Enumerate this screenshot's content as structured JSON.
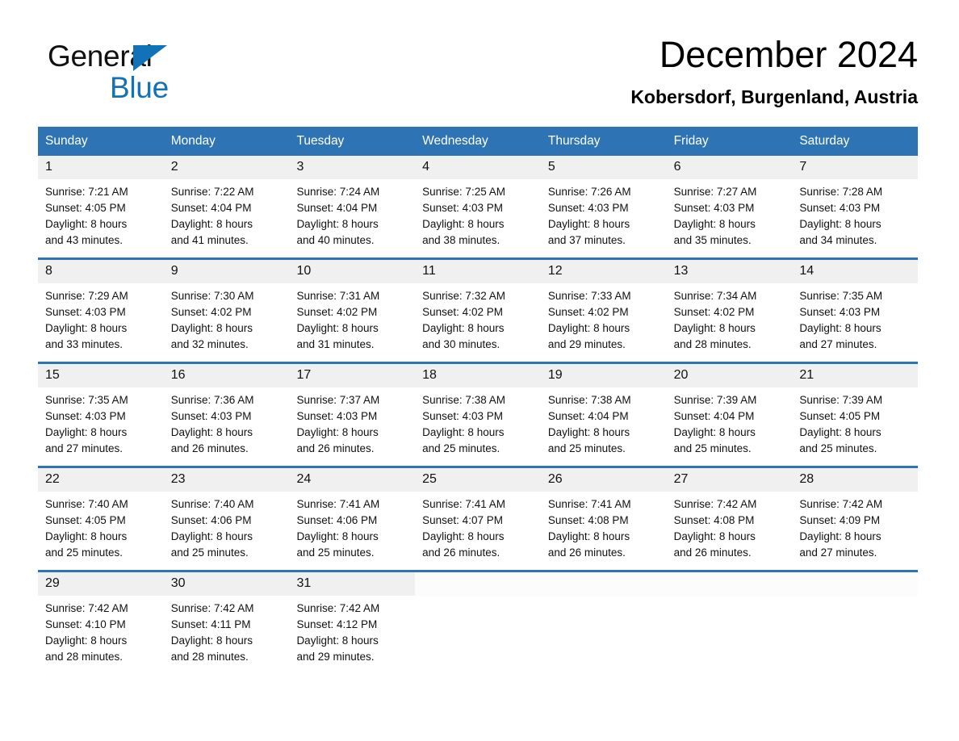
{
  "brand": {
    "name_top": "General",
    "name_bottom": "Blue",
    "accent_color": "#1272b8",
    "triangle_icon": "brand-triangle-icon"
  },
  "header": {
    "title": "December 2024",
    "subtitle": "Kobersdorf, Burgenland, Austria"
  },
  "theme": {
    "header_blue": "#2e74b5",
    "daynum_band": "#f0f0f0",
    "text": "#111111"
  },
  "calendar": {
    "weekdays": [
      "Sunday",
      "Monday",
      "Tuesday",
      "Wednesday",
      "Thursday",
      "Friday",
      "Saturday"
    ],
    "weeks": [
      [
        {
          "day": "1",
          "sunrise": "Sunrise: 7:21 AM",
          "sunset": "Sunset: 4:05 PM",
          "daylight1": "Daylight: 8 hours",
          "daylight2": "and 43 minutes."
        },
        {
          "day": "2",
          "sunrise": "Sunrise: 7:22 AM",
          "sunset": "Sunset: 4:04 PM",
          "daylight1": "Daylight: 8 hours",
          "daylight2": "and 41 minutes."
        },
        {
          "day": "3",
          "sunrise": "Sunrise: 7:24 AM",
          "sunset": "Sunset: 4:04 PM",
          "daylight1": "Daylight: 8 hours",
          "daylight2": "and 40 minutes."
        },
        {
          "day": "4",
          "sunrise": "Sunrise: 7:25 AM",
          "sunset": "Sunset: 4:03 PM",
          "daylight1": "Daylight: 8 hours",
          "daylight2": "and 38 minutes."
        },
        {
          "day": "5",
          "sunrise": "Sunrise: 7:26 AM",
          "sunset": "Sunset: 4:03 PM",
          "daylight1": "Daylight: 8 hours",
          "daylight2": "and 37 minutes."
        },
        {
          "day": "6",
          "sunrise": "Sunrise: 7:27 AM",
          "sunset": "Sunset: 4:03 PM",
          "daylight1": "Daylight: 8 hours",
          "daylight2": "and 35 minutes."
        },
        {
          "day": "7",
          "sunrise": "Sunrise: 7:28 AM",
          "sunset": "Sunset: 4:03 PM",
          "daylight1": "Daylight: 8 hours",
          "daylight2": "and 34 minutes."
        }
      ],
      [
        {
          "day": "8",
          "sunrise": "Sunrise: 7:29 AM",
          "sunset": "Sunset: 4:03 PM",
          "daylight1": "Daylight: 8 hours",
          "daylight2": "and 33 minutes."
        },
        {
          "day": "9",
          "sunrise": "Sunrise: 7:30 AM",
          "sunset": "Sunset: 4:02 PM",
          "daylight1": "Daylight: 8 hours",
          "daylight2": "and 32 minutes."
        },
        {
          "day": "10",
          "sunrise": "Sunrise: 7:31 AM",
          "sunset": "Sunset: 4:02 PM",
          "daylight1": "Daylight: 8 hours",
          "daylight2": "and 31 minutes."
        },
        {
          "day": "11",
          "sunrise": "Sunrise: 7:32 AM",
          "sunset": "Sunset: 4:02 PM",
          "daylight1": "Daylight: 8 hours",
          "daylight2": "and 30 minutes."
        },
        {
          "day": "12",
          "sunrise": "Sunrise: 7:33 AM",
          "sunset": "Sunset: 4:02 PM",
          "daylight1": "Daylight: 8 hours",
          "daylight2": "and 29 minutes."
        },
        {
          "day": "13",
          "sunrise": "Sunrise: 7:34 AM",
          "sunset": "Sunset: 4:02 PM",
          "daylight1": "Daylight: 8 hours",
          "daylight2": "and 28 minutes."
        },
        {
          "day": "14",
          "sunrise": "Sunrise: 7:35 AM",
          "sunset": "Sunset: 4:03 PM",
          "daylight1": "Daylight: 8 hours",
          "daylight2": "and 27 minutes."
        }
      ],
      [
        {
          "day": "15",
          "sunrise": "Sunrise: 7:35 AM",
          "sunset": "Sunset: 4:03 PM",
          "daylight1": "Daylight: 8 hours",
          "daylight2": "and 27 minutes."
        },
        {
          "day": "16",
          "sunrise": "Sunrise: 7:36 AM",
          "sunset": "Sunset: 4:03 PM",
          "daylight1": "Daylight: 8 hours",
          "daylight2": "and 26 minutes."
        },
        {
          "day": "17",
          "sunrise": "Sunrise: 7:37 AM",
          "sunset": "Sunset: 4:03 PM",
          "daylight1": "Daylight: 8 hours",
          "daylight2": "and 26 minutes."
        },
        {
          "day": "18",
          "sunrise": "Sunrise: 7:38 AM",
          "sunset": "Sunset: 4:03 PM",
          "daylight1": "Daylight: 8 hours",
          "daylight2": "and 25 minutes."
        },
        {
          "day": "19",
          "sunrise": "Sunrise: 7:38 AM",
          "sunset": "Sunset: 4:04 PM",
          "daylight1": "Daylight: 8 hours",
          "daylight2": "and 25 minutes."
        },
        {
          "day": "20",
          "sunrise": "Sunrise: 7:39 AM",
          "sunset": "Sunset: 4:04 PM",
          "daylight1": "Daylight: 8 hours",
          "daylight2": "and 25 minutes."
        },
        {
          "day": "21",
          "sunrise": "Sunrise: 7:39 AM",
          "sunset": "Sunset: 4:05 PM",
          "daylight1": "Daylight: 8 hours",
          "daylight2": "and 25 minutes."
        }
      ],
      [
        {
          "day": "22",
          "sunrise": "Sunrise: 7:40 AM",
          "sunset": "Sunset: 4:05 PM",
          "daylight1": "Daylight: 8 hours",
          "daylight2": "and 25 minutes."
        },
        {
          "day": "23",
          "sunrise": "Sunrise: 7:40 AM",
          "sunset": "Sunset: 4:06 PM",
          "daylight1": "Daylight: 8 hours",
          "daylight2": "and 25 minutes."
        },
        {
          "day": "24",
          "sunrise": "Sunrise: 7:41 AM",
          "sunset": "Sunset: 4:06 PM",
          "daylight1": "Daylight: 8 hours",
          "daylight2": "and 25 minutes."
        },
        {
          "day": "25",
          "sunrise": "Sunrise: 7:41 AM",
          "sunset": "Sunset: 4:07 PM",
          "daylight1": "Daylight: 8 hours",
          "daylight2": "and 26 minutes."
        },
        {
          "day": "26",
          "sunrise": "Sunrise: 7:41 AM",
          "sunset": "Sunset: 4:08 PM",
          "daylight1": "Daylight: 8 hours",
          "daylight2": "and 26 minutes."
        },
        {
          "day": "27",
          "sunrise": "Sunrise: 7:42 AM",
          "sunset": "Sunset: 4:08 PM",
          "daylight1": "Daylight: 8 hours",
          "daylight2": "and 26 minutes."
        },
        {
          "day": "28",
          "sunrise": "Sunrise: 7:42 AM",
          "sunset": "Sunset: 4:09 PM",
          "daylight1": "Daylight: 8 hours",
          "daylight2": "and 27 minutes."
        }
      ],
      [
        {
          "day": "29",
          "sunrise": "Sunrise: 7:42 AM",
          "sunset": "Sunset: 4:10 PM",
          "daylight1": "Daylight: 8 hours",
          "daylight2": "and 28 minutes."
        },
        {
          "day": "30",
          "sunrise": "Sunrise: 7:42 AM",
          "sunset": "Sunset: 4:11 PM",
          "daylight1": "Daylight: 8 hours",
          "daylight2": "and 28 minutes."
        },
        {
          "day": "31",
          "sunrise": "Sunrise: 7:42 AM",
          "sunset": "Sunset: 4:12 PM",
          "daylight1": "Daylight: 8 hours",
          "daylight2": "and 29 minutes."
        },
        {
          "day": "",
          "sunrise": "",
          "sunset": "",
          "daylight1": "",
          "daylight2": ""
        },
        {
          "day": "",
          "sunrise": "",
          "sunset": "",
          "daylight1": "",
          "daylight2": ""
        },
        {
          "day": "",
          "sunrise": "",
          "sunset": "",
          "daylight1": "",
          "daylight2": ""
        },
        {
          "day": "",
          "sunrise": "",
          "sunset": "",
          "daylight1": "",
          "daylight2": ""
        }
      ]
    ]
  }
}
